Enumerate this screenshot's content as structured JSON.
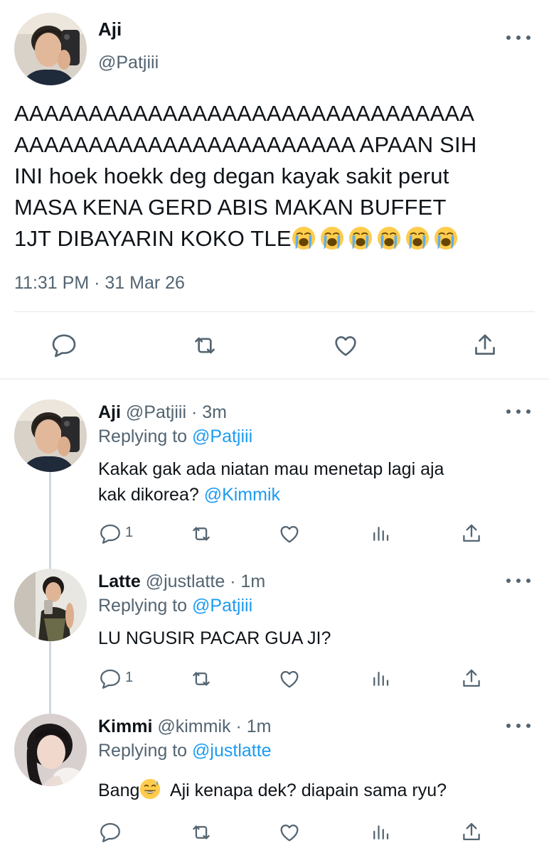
{
  "main": {
    "name": "Aji",
    "handle": "@Patjiii",
    "text": "AAAAAAAAAAAAAAAAAAAAAAAAAAAAAAA\nAAAAAAAAAAAAAAAAAAAAAAA APAAN SIH\nINI hoek hoekk deg degan kayak sakit perut\nMASA KENA GERD ABIS MAKAN BUFFET\n1JT DIBAYARIN KOKO TLE",
    "emoji_count": 6,
    "emoji_icon": "loudly-crying-face-emoji",
    "timestamp": "11:31 PM · 31 Mar 26"
  },
  "replies": [
    {
      "name": "Aji",
      "handle": "@Patjiii",
      "time": "· 3m",
      "replying_prefix": "Replying to ",
      "replying_to": "@Patjiii",
      "text_line1": "Kakak gak ada niatan mau menetap lagi aja",
      "text_line2_prefix": "kak dikorea? ",
      "text_line2_mention": "@Kimmik",
      "reply_count": "1"
    },
    {
      "name": "Latte",
      "handle": "@justlatte",
      "time": "· 1m",
      "replying_prefix": "Replying to ",
      "replying_to": "@Patjiii",
      "text": "LU NGUSIR PACAR GUA JI?",
      "reply_count": "1"
    },
    {
      "name": "Kimmi",
      "handle": "@kimmik",
      "time": "· 1m",
      "replying_prefix": "Replying to ",
      "replying_to": "@justlatte",
      "text_before_emoji": "Bang",
      "emoji_icon": "grinning-sweat-emoji",
      "text_after_emoji": "  Aji kenapa dek? diapain sama ryu?"
    }
  ],
  "colors": {
    "text": "#0f1419",
    "secondary": "#536471",
    "link": "#1d9bf0",
    "divider": "#e6e9ec",
    "thread_line": "#cfd9de"
  }
}
